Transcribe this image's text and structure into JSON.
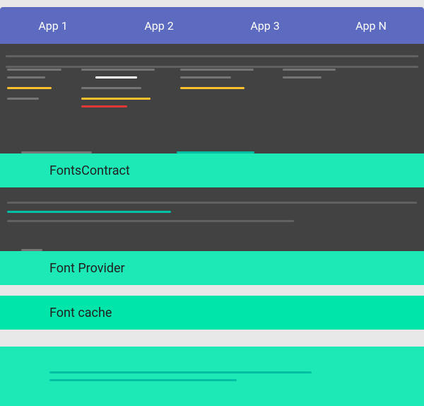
{
  "appBar": {
    "tabs": [
      {
        "label": "App 1"
      },
      {
        "label": "App 2"
      },
      {
        "label": "App 3"
      },
      {
        "label": "App N"
      }
    ]
  },
  "sections": {
    "fontsContract": "FontsContract",
    "fontProvider": "Font Provider",
    "fontCache": "Font cache"
  },
  "colors": {
    "appBar": "#5c6bc0",
    "darkSection": "#424242",
    "tealBright": "#1de9b6",
    "tealDark": "#00e5aa"
  }
}
